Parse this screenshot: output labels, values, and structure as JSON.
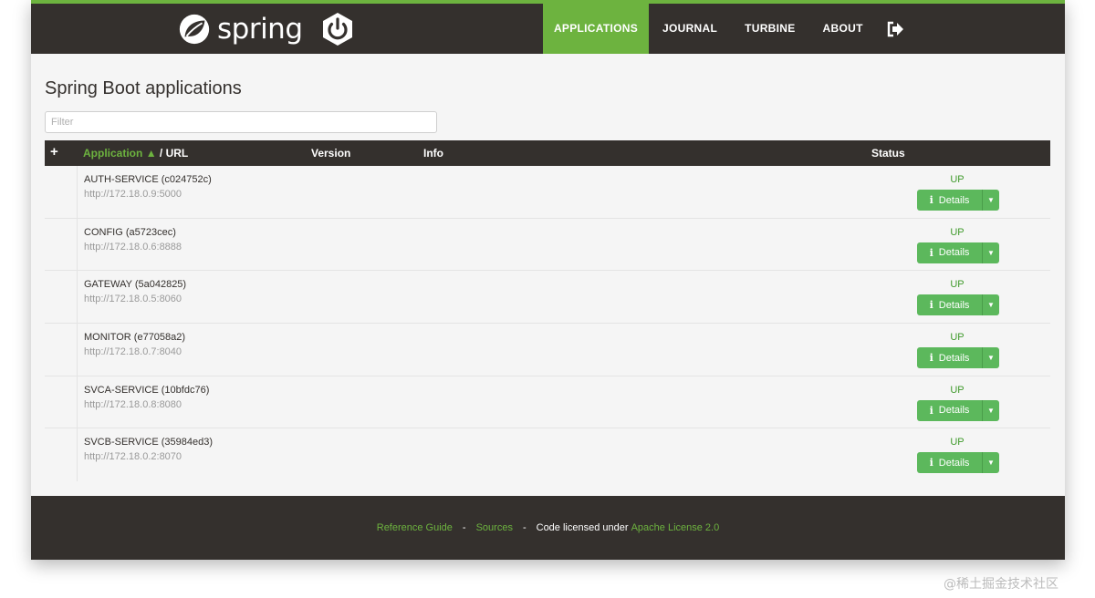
{
  "header": {
    "brand": "spring",
    "nav": [
      {
        "label": "APPLICATIONS",
        "active": true
      },
      {
        "label": "JOURNAL",
        "active": false
      },
      {
        "label": "TURBINE",
        "active": false
      },
      {
        "label": "ABOUT",
        "active": false
      }
    ],
    "logout_icon": "sign-out-icon"
  },
  "page": {
    "title": "Spring Boot applications",
    "filter_placeholder": "Filter"
  },
  "table": {
    "columns": {
      "add": "+",
      "application": "Application",
      "sort_indicator": "▲",
      "url": "/ URL",
      "version": "Version",
      "info": "Info",
      "status": "Status"
    },
    "rows": [
      {
        "name": "AUTH-SERVICE (c024752c)",
        "url": "http://172.18.0.9:5000",
        "status": "UP",
        "details": "Details"
      },
      {
        "name": "CONFIG (a5723cec)",
        "url": "http://172.18.0.6:8888",
        "status": "UP",
        "details": "Details"
      },
      {
        "name": "GATEWAY (5a042825)",
        "url": "http://172.18.0.5:8060",
        "status": "UP",
        "details": "Details"
      },
      {
        "name": "MONITOR (e77058a2)",
        "url": "http://172.18.0.7:8040",
        "status": "UP",
        "details": "Details"
      },
      {
        "name": "SVCA-SERVICE (10bfdc76)",
        "url": "http://172.18.0.8:8080",
        "status": "UP",
        "details": "Details"
      },
      {
        "name": "SVCB-SERVICE (35984ed3)",
        "url": "http://172.18.0.2:8070",
        "status": "UP",
        "details": "Details"
      }
    ]
  },
  "footer": {
    "reference_guide": "Reference Guide",
    "sep": "-",
    "sources": "Sources",
    "license_text": "Code licensed under",
    "license_link": "Apache License 2.0"
  },
  "watermark": "@稀土掘金技术社区",
  "colors": {
    "brand_green": "#6db33f",
    "dark": "#34302d",
    "button_green": "#5cb85c",
    "status_green": "#3f9a2b"
  }
}
